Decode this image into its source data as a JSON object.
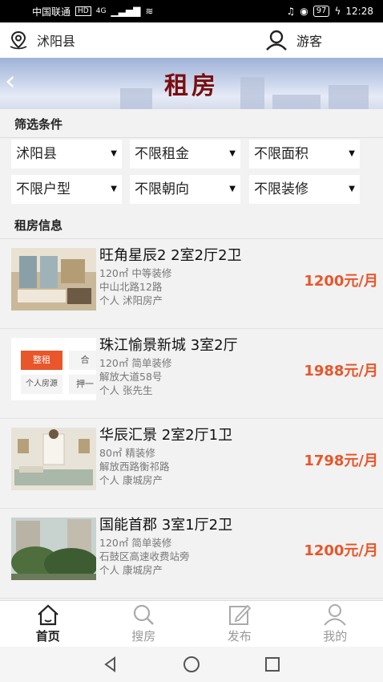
{
  "status": {
    "carrier": "中国联通",
    "hd": "HD",
    "signal": "4G",
    "battery": "97",
    "time": "12:28"
  },
  "topbar": {
    "location": "沭阳县",
    "user": "游客"
  },
  "banner": {
    "title": "租房"
  },
  "filters": {
    "title": "筛选条件",
    "selects": [
      "沭阳县",
      "不限租金",
      "不限面积",
      "不限户型",
      "不限朝向",
      "不限装修"
    ]
  },
  "list_title": "租房信息",
  "listings": [
    {
      "name": "旺角星辰2 2室2厅2卫",
      "detail": "120㎡ 中等装修",
      "address": "中山北路12路",
      "owner": "个人 沭阳房产",
      "price": "1200元/月"
    },
    {
      "name": "珠江愉景新城 3室2厅",
      "detail": "120㎡ 简单装修",
      "address": "解放大道58号",
      "owner": "个人 张先生",
      "price": "1988元/月",
      "thumb_tags": [
        "整租",
        "合",
        "个人房源",
        "押一"
      ]
    },
    {
      "name": "华辰汇景 2室2厅1卫",
      "detail": "80㎡ 精装修",
      "address": "解放西路衡祁路",
      "owner": "个人 康城房产",
      "price": "1798元/月"
    },
    {
      "name": "国能首郡 3室1厅2卫",
      "detail": "120㎡ 简单装修",
      "address": "石鼓区高速收费站旁",
      "owner": "个人 康城房产",
      "price": "1200元/月"
    }
  ],
  "tabs": [
    {
      "label": "首页",
      "icon": "home-icon",
      "active": true
    },
    {
      "label": "搜房",
      "icon": "search-icon",
      "active": false
    },
    {
      "label": "发布",
      "icon": "edit-icon",
      "active": false
    },
    {
      "label": "我的",
      "icon": "profile-icon",
      "active": false
    }
  ],
  "colors": {
    "price": "#e8562a",
    "title": "#7a0e0e",
    "active_tab": "#222222"
  }
}
